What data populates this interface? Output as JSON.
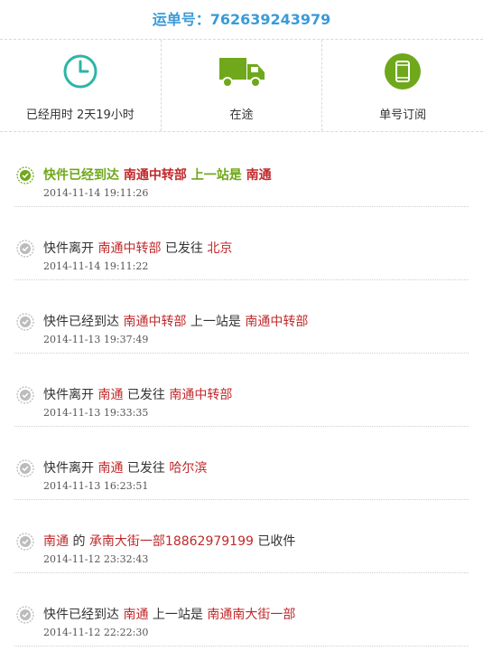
{
  "header": {
    "label": "运单号：",
    "number": "762639243979"
  },
  "stats": [
    {
      "icon": "clock-icon",
      "label": "已经用时 2天19小时"
    },
    {
      "icon": "truck-icon",
      "label": "在途"
    },
    {
      "icon": "phone-icon",
      "label": "单号订阅"
    }
  ],
  "colors": {
    "accent": "#3a9bd8",
    "teal": "#2cb5a7",
    "green": "#6fa81a",
    "place": "#c0292b"
  },
  "events": [
    {
      "status": "latest",
      "parts": [
        "快件已经到达 ",
        "南通中转部",
        " 上一站是 ",
        "南通"
      ],
      "time": "2014-11-14 19:11:26"
    },
    {
      "status": "done",
      "parts": [
        "快件离开 ",
        "南通中转部",
        " 已发往 ",
        "北京"
      ],
      "time": "2014-11-14 19:11:22"
    },
    {
      "status": "done",
      "parts": [
        "快件已经到达 ",
        "南通中转部",
        " 上一站是 ",
        "南通中转部"
      ],
      "time": "2014-11-13 19:37:49"
    },
    {
      "status": "done",
      "parts": [
        "快件离开 ",
        "南通",
        " 已发往 ",
        "南通中转部"
      ],
      "time": "2014-11-13 19:33:35"
    },
    {
      "status": "done",
      "parts": [
        "快件离开 ",
        "南通",
        " 已发往 ",
        "哈尔滨"
      ],
      "time": "2014-11-13 16:23:51"
    },
    {
      "status": "done",
      "parts": [
        "",
        "南通",
        " 的 ",
        "承南大街一部18862979199",
        " 已收件"
      ],
      "time": "2014-11-12 23:32:43"
    },
    {
      "status": "done",
      "parts": [
        "快件已经到达 ",
        "南通",
        " 上一站是 ",
        "南通南大街一部"
      ],
      "time": "2014-11-12 22:22:30"
    }
  ]
}
